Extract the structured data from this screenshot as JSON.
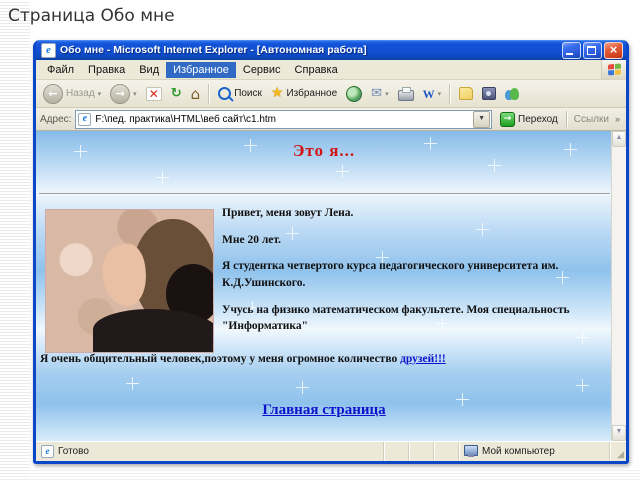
{
  "slide": {
    "title": "Страница Обо мне"
  },
  "colors": {
    "titlebar_blue": "#1150d2",
    "chrome_tan": "#ece9d8",
    "heading_red": "#d21414",
    "link_blue": "#0f12cc",
    "content_blue": "#8fc2ec"
  },
  "window": {
    "title": "Обо мне - Microsoft Internet Explorer - [Автономная работа]",
    "menu": {
      "items": [
        "Файл",
        "Правка",
        "Вид",
        "Избранное",
        "Сервис",
        "Справка"
      ],
      "active_item": "Избранное"
    },
    "toolbar": {
      "back": "Назад",
      "search": "Поиск",
      "favorites": "Избранное"
    },
    "address": {
      "label": "Адрес:",
      "value": "F:\\пед. практика\\HTML\\веб сайт\\c1.htm",
      "go": "Переход",
      "links": "Ссылки",
      "links_chevron": "»"
    },
    "status": {
      "ready": "Готово",
      "zone": "Мой компьютер"
    }
  },
  "page": {
    "heading": "Это я...",
    "paragraphs": [
      "Привет, меня зовут Лена.",
      "Мне 20 лет.",
      "Я студентка четвертого курса педагогического университета им. К.Д.Ушинского.",
      "Учусь на физико математическом факультете. Моя специальность \"Информатика\""
    ],
    "friends_prefix": "Я очень общительный человек,поэтому у меня огромное количество ",
    "friends_link": "друзей!!!",
    "home_link": "Главная страница"
  }
}
